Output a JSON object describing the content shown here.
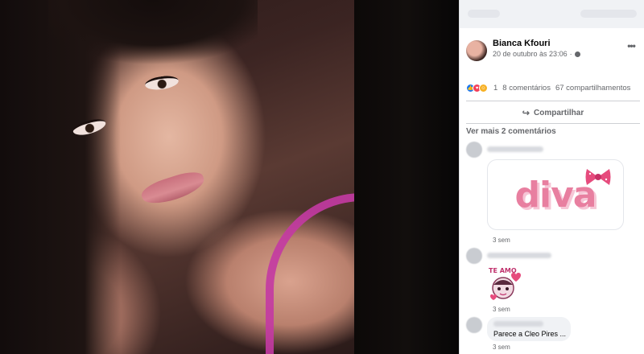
{
  "post": {
    "author": "Bianca Kfouri",
    "timestamp": "20 de outubro às 23:06",
    "privacy_icon": "globe-icon",
    "more_icon": "•••"
  },
  "stats": {
    "reactions_count": "1",
    "comments": "8 comentários",
    "shares": "67 compartilhamentos",
    "reaction_icons": [
      "like",
      "love",
      "haha"
    ]
  },
  "actions": {
    "share_label": "Compartilhar",
    "share_icon": "↪"
  },
  "comments_section": {
    "more_comments": "Ver mais 2 comentários",
    "items": [
      {
        "sticker_text": "diva",
        "time": "3 sem"
      },
      {
        "sticker_text": "TE AMO",
        "time": "3 sem"
      },
      {
        "text": "Parece a Cleo Pires ...",
        "time": "3 sem"
      }
    ]
  },
  "colors": {
    "accent": "#1877f2",
    "secondary_text": "#65676b",
    "divider": "#ced0d4",
    "diva_pink": "#e87fa0",
    "strap_pink": "#c43aa3"
  }
}
